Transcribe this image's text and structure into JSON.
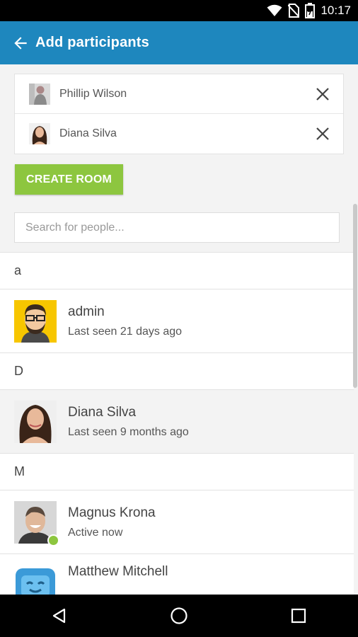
{
  "status_bar": {
    "time": "10:17",
    "icons": [
      "wifi-icon",
      "no-sim-icon",
      "battery-icon"
    ]
  },
  "app_bar": {
    "title": "Add participants",
    "back_icon": "arrow-back-icon",
    "color": "#1e87be"
  },
  "selected_participants": [
    {
      "name": "Phillip Wilson",
      "remove_icon": "close-icon"
    },
    {
      "name": "Diana Silva",
      "remove_icon": "close-icon"
    }
  ],
  "create_button": {
    "label": "CREATE ROOM",
    "color": "#8dc63f"
  },
  "search": {
    "placeholder": "Search for people...",
    "value": ""
  },
  "contacts": [
    {
      "section": "a",
      "people": [
        {
          "name": "admin",
          "status": "Last seen 21 days ago",
          "online": false
        }
      ]
    },
    {
      "section": "D",
      "people": [
        {
          "name": "Diana Silva",
          "status": "Last seen 9 months ago",
          "online": false,
          "selected": true
        }
      ]
    },
    {
      "section": "M",
      "people": [
        {
          "name": "Magnus Krona",
          "status": "Active now",
          "online": true
        },
        {
          "name": "Matthew Mitchell",
          "status": "",
          "online": false
        }
      ]
    }
  ],
  "nav_bar": {
    "buttons": [
      "back-triangle-icon",
      "home-circle-icon",
      "recents-square-icon"
    ]
  }
}
